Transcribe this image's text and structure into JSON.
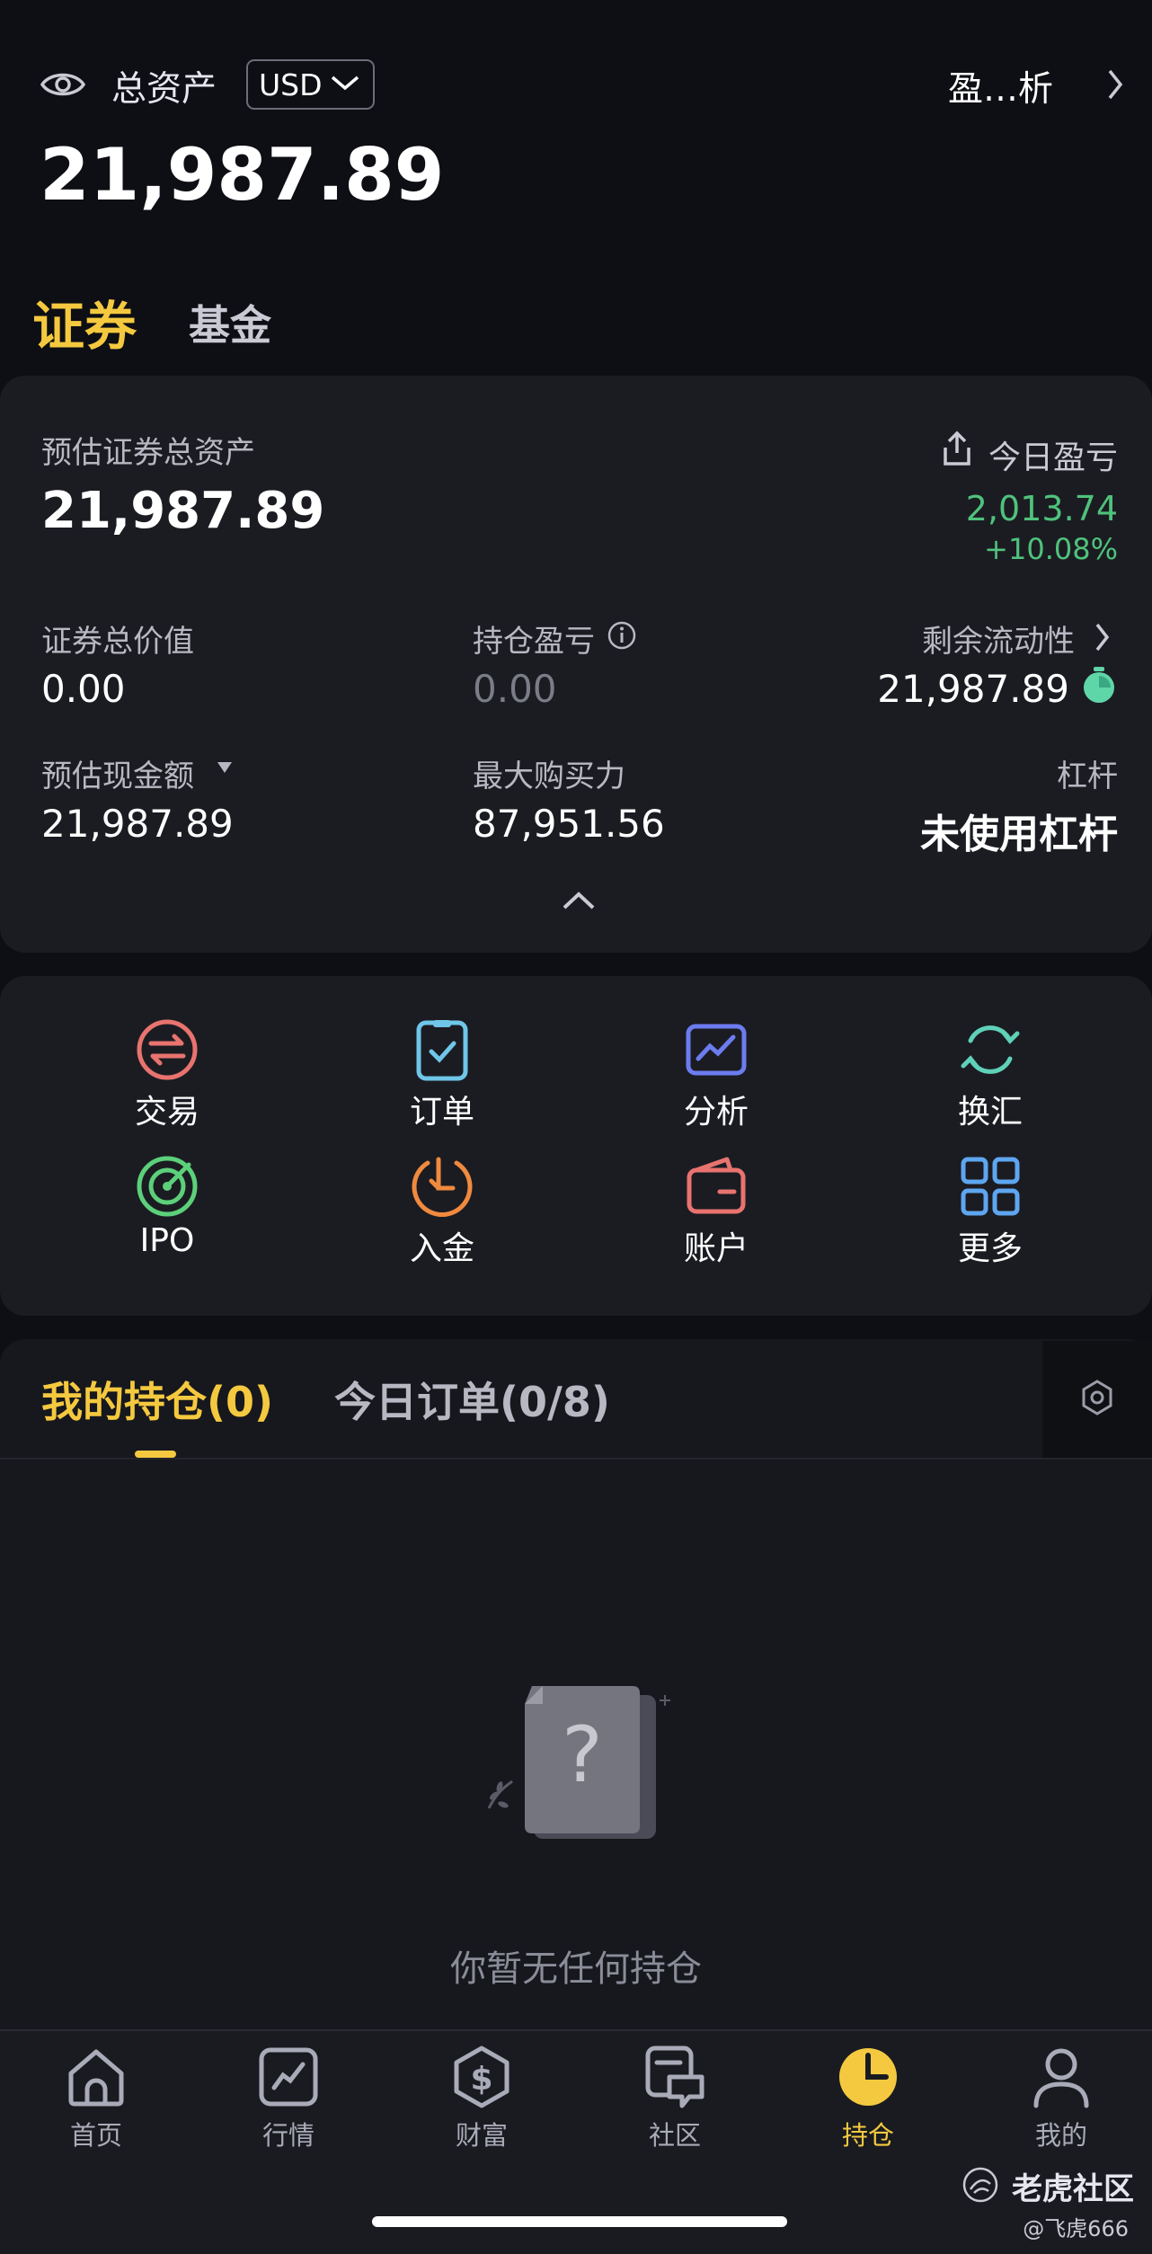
{
  "header": {
    "total_label": "总资产",
    "currency": "USD",
    "analysis_link": "盈…析",
    "total_value": "21,987.89"
  },
  "category_tabs": [
    {
      "label": "证券",
      "active": true
    },
    {
      "label": "基金",
      "active": false
    }
  ],
  "summary": {
    "est_total_label": "预估证券总资产",
    "est_total_value": "21,987.89",
    "today_pl_label": "今日盈亏",
    "today_pl_value": "2,013.74",
    "today_pl_pct": "+10.08%",
    "sec_value_label": "证券总价值",
    "sec_value": "0.00",
    "pos_pl_label": "持仓盈亏",
    "pos_pl_value": "0.00",
    "liquidity_label": "剩余流动性",
    "liquidity_value": "21,987.89",
    "cash_label": "预估现金额",
    "cash_value": "21,987.89",
    "buying_power_label": "最大购买力",
    "buying_power_value": "87,951.56",
    "leverage_label": "杠杆",
    "leverage_value": "未使用杠杆"
  },
  "actions": [
    {
      "label": "交易",
      "icon": "trade-icon",
      "color": "#e8736f"
    },
    {
      "label": "订单",
      "icon": "order-icon",
      "color": "#6fc6e8"
    },
    {
      "label": "分析",
      "icon": "analysis-icon",
      "color": "#6c7cf0"
    },
    {
      "label": "换汇",
      "icon": "exchange-icon",
      "color": "#5fd1b8"
    },
    {
      "label": "IPO",
      "icon": "ipo-icon",
      "color": "#5cd07a"
    },
    {
      "label": "入金",
      "icon": "deposit-icon",
      "color": "#f08a3e"
    },
    {
      "label": "账户",
      "icon": "account-icon",
      "color": "#e8736f"
    },
    {
      "label": "更多",
      "icon": "more-icon",
      "color": "#5ea6f0"
    }
  ],
  "holdings_tabs": [
    {
      "label": "我的持仓(0)",
      "active": true
    },
    {
      "label": "今日订单(0/8)",
      "active": false
    }
  ],
  "empty_state": {
    "text": "你暂无任何持仓"
  },
  "bottom_nav": [
    {
      "label": "首页",
      "icon": "home-icon",
      "active": false
    },
    {
      "label": "行情",
      "icon": "market-icon",
      "active": false
    },
    {
      "label": "财富",
      "icon": "wealth-icon",
      "active": false
    },
    {
      "label": "社区",
      "icon": "community-icon",
      "active": false
    },
    {
      "label": "持仓",
      "icon": "holdings-icon",
      "active": true
    },
    {
      "label": "我的",
      "icon": "profile-icon",
      "active": false
    }
  ],
  "watermark": {
    "brand": "老虎社区",
    "user": "@飞虎666"
  },
  "colors": {
    "accent": "#f5c93f",
    "positive": "#4fc27c",
    "background": "#0e0f14",
    "card": "#1b1c22"
  }
}
